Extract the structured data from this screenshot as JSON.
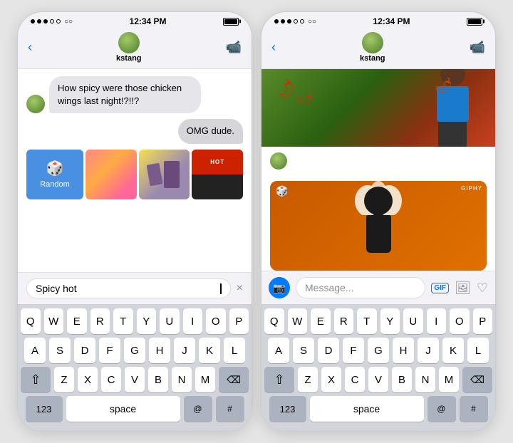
{
  "phone1": {
    "status_bar": {
      "time": "12:34 PM",
      "dots": [
        "filled",
        "filled",
        "filled",
        "empty",
        "empty"
      ]
    },
    "nav": {
      "back_label": "‹",
      "username": "kstang",
      "video_icon": "▭"
    },
    "messages": [
      {
        "type": "received",
        "text": "How spicy were those chicken wings last night!?!!?"
      },
      {
        "type": "sent",
        "text": "OMG dude."
      }
    ],
    "gif_grid": {
      "random_label": "Random",
      "dice_icon": "🎲"
    },
    "search": {
      "value": "Spicy hot",
      "clear_icon": "×"
    },
    "keyboard": {
      "row1": [
        "Q",
        "W",
        "E",
        "R",
        "T",
        "Y",
        "U",
        "I",
        "O",
        "P"
      ],
      "row2": [
        "A",
        "S",
        "D",
        "F",
        "G",
        "H",
        "J",
        "K",
        "L"
      ],
      "row3": [
        "Z",
        "X",
        "C",
        "V",
        "B",
        "N",
        "M"
      ],
      "shift_icon": "⇧",
      "delete_icon": "⌫",
      "num_label": "123",
      "space_label": "space",
      "at_label": "@",
      "hash_label": "#"
    }
  },
  "phone2": {
    "status_bar": {
      "time": "12:34 PM",
      "dots": [
        "filled",
        "filled",
        "filled",
        "empty",
        "empty"
      ]
    },
    "nav": {
      "back_label": "‹",
      "username": "kstang",
      "video_icon": "▭"
    },
    "message_input": {
      "placeholder": "Message...",
      "gif_label": "GIF",
      "camera_icon": "📷"
    },
    "keyboard": {
      "row1": [
        "Q",
        "W",
        "E",
        "R",
        "T",
        "Y",
        "U",
        "I",
        "O",
        "P"
      ],
      "row2": [
        "A",
        "S",
        "D",
        "F",
        "G",
        "H",
        "J",
        "K",
        "L"
      ],
      "row3": [
        "Z",
        "X",
        "C",
        "V",
        "B",
        "N",
        "M"
      ],
      "shift_icon": "⇧",
      "delete_icon": "⌫",
      "num_label": "123",
      "space_label": "space",
      "at_label": "@",
      "hash_label": "#"
    },
    "giphy_label": "GIPHY"
  }
}
